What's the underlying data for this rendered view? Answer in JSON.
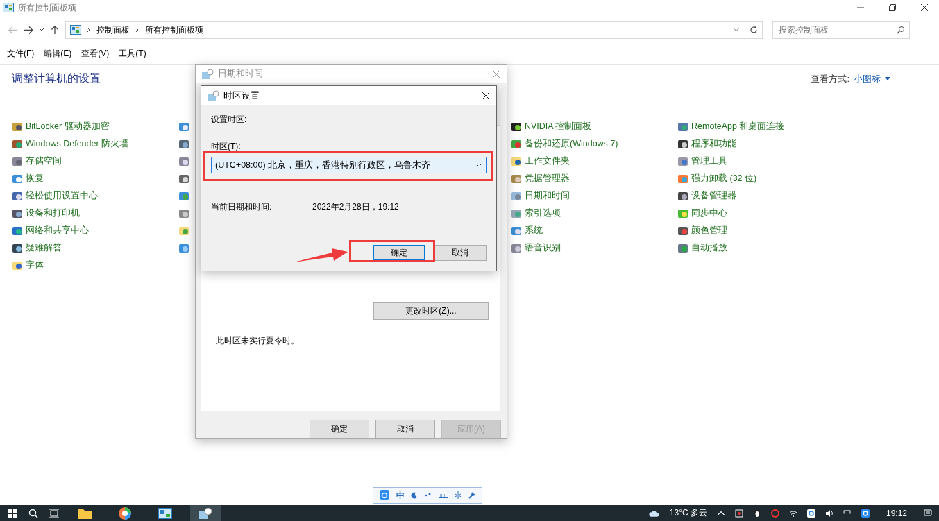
{
  "window": {
    "title": "所有控制面板项"
  },
  "address": {
    "crumbs": [
      "控制面板",
      "所有控制面板项"
    ]
  },
  "search": {
    "placeholder": "搜索控制面板"
  },
  "menu": [
    "文件(F)",
    "编辑(E)",
    "查看(V)",
    "工具(T)"
  ],
  "header": {
    "title": "调整计算机的设置",
    "view_label": "查看方式:",
    "view_value": "小图标"
  },
  "columns": [
    [
      "BitLocker 驱动器加密",
      "Windows Defender 防火墙",
      "存储空间",
      "恢复",
      "轻松使用设置中心",
      "设备和打印机",
      "网络和共享中心",
      "疑难解答",
      "字体"
    ],
    [
      "NVIDIA 控制面板",
      "备份和还原(Windows 7)",
      "工作文件夹",
      "凭据管理器",
      "日期和时间",
      "索引选项",
      "系统",
      "语音识别"
    ],
    [
      "RemoteApp 和桌面连接",
      "程序和功能",
      "管理工具",
      "强力卸载 (32 位)",
      "设备管理器",
      "同步中心",
      "颜色管理",
      "自动播放"
    ]
  ],
  "back_dialog": {
    "title": "日期和时间",
    "change_button": "更改时区(Z)...",
    "dst_note": "此时区未实行夏令时。",
    "buttons": [
      {
        "label": "确定",
        "disabled": false
      },
      {
        "label": "取消",
        "disabled": false
      },
      {
        "label": "应用(A)",
        "disabled": true
      }
    ]
  },
  "front_dialog": {
    "title": "时区设置",
    "heading": "设置时区:",
    "zone_label": "时区(T):",
    "zone_value": "(UTC+08:00) 北京，重庆，香港特别行政区，乌鲁木齐",
    "current_label": "当前日期和时间:",
    "current_value": "2022年2月28日，19:12",
    "buttons": [
      {
        "label": "确定",
        "selected": true
      },
      {
        "label": "取消",
        "selected": false
      }
    ]
  },
  "ime_bar": {
    "mode": "中"
  },
  "taskbar": {
    "apps": [
      {
        "selected": false
      },
      {
        "selected": false
      },
      {
        "selected": false
      },
      {
        "selected": true
      }
    ],
    "weather": "13°C 多云",
    "ime": "中",
    "time": "19:12"
  }
}
